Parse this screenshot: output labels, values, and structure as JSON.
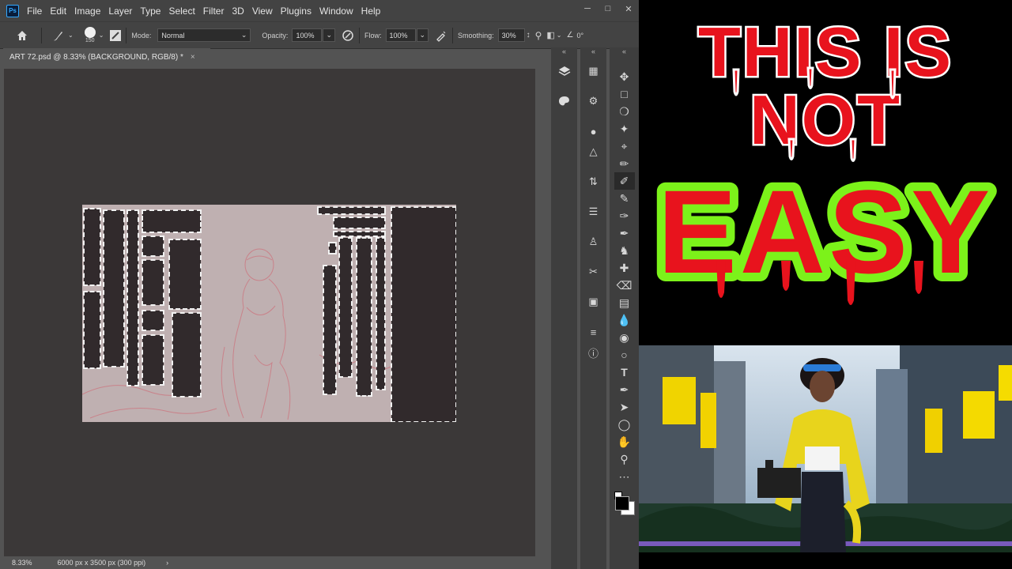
{
  "menubar": {
    "app_logo": "Ps",
    "items": [
      "File",
      "Edit",
      "Image",
      "Layer",
      "Type",
      "Select",
      "Filter",
      "3D",
      "View",
      "Plugins",
      "Window",
      "Help"
    ]
  },
  "options": {
    "brush_size": "150",
    "mode_label": "Mode:",
    "mode_value": "Normal",
    "opacity_label": "Opacity:",
    "opacity_value": "100%",
    "flow_label": "Flow:",
    "flow_value": "100%",
    "smoothing_label": "Smoothing:",
    "smoothing_value": "30%",
    "angle_value": "0°"
  },
  "document": {
    "tab_title": "ART 72.psd @ 8.33% (BACKGROUND, RGB/8) *",
    "close_glyph": "×"
  },
  "status": {
    "zoom": "8.33%",
    "dimensions": "6000 px x 3500 px (300 ppi)",
    "arrow": "›"
  },
  "thumbnail": {
    "line1": "THIS IS",
    "line2": "NOT",
    "line3": "EASY"
  },
  "colors": {
    "accent_blue": "#31a8ff",
    "drip_red": "#e8131d",
    "glow_green": "#7cf21a",
    "selection": "#f2f2f2"
  }
}
